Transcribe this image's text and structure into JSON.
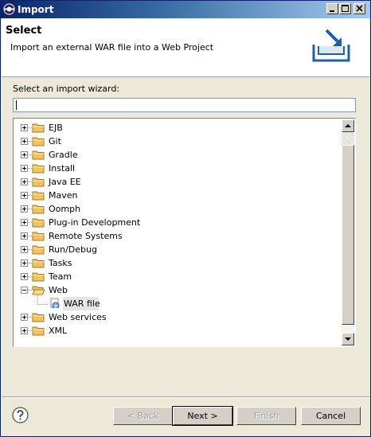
{
  "window": {
    "title": "Import",
    "icons": {
      "app": "eclipse-icon",
      "minimize": "minimize-icon",
      "maximize": "maximize-icon",
      "close": "close-icon"
    }
  },
  "header": {
    "title": "Select",
    "description": "Import an external WAR file into a Web Project",
    "graphic": "import-wizard-banner-icon"
  },
  "wizard": {
    "label": "Select an import wizard:",
    "filter_value": ""
  },
  "tree": {
    "items": [
      {
        "label": "EJB",
        "expanded": false,
        "icon": "folder-icon"
      },
      {
        "label": "Git",
        "expanded": false,
        "icon": "folder-icon"
      },
      {
        "label": "Gradle",
        "expanded": false,
        "icon": "folder-icon"
      },
      {
        "label": "Install",
        "expanded": false,
        "icon": "folder-icon"
      },
      {
        "label": "Java EE",
        "expanded": false,
        "icon": "folder-icon"
      },
      {
        "label": "Maven",
        "expanded": false,
        "icon": "folder-icon"
      },
      {
        "label": "Oomph",
        "expanded": false,
        "icon": "folder-icon"
      },
      {
        "label": "Plug-in Development",
        "expanded": false,
        "icon": "folder-icon"
      },
      {
        "label": "Remote Systems",
        "expanded": false,
        "icon": "folder-icon"
      },
      {
        "label": "Run/Debug",
        "expanded": false,
        "icon": "folder-icon"
      },
      {
        "label": "Tasks",
        "expanded": false,
        "icon": "folder-icon"
      },
      {
        "label": "Team",
        "expanded": false,
        "icon": "folder-icon"
      },
      {
        "label": "Web",
        "expanded": true,
        "icon": "folder-open-icon"
      },
      {
        "label": "WAR file",
        "child": true,
        "selected": true,
        "icon": "war-file-icon"
      },
      {
        "label": "Web services",
        "expanded": false,
        "icon": "folder-icon"
      },
      {
        "label": "XML",
        "expanded": false,
        "icon": "folder-icon"
      }
    ]
  },
  "buttons": {
    "help": "help-icon",
    "back": "< Back",
    "next": "Next >",
    "finish": "Finish",
    "cancel": "Cancel"
  },
  "colors": {
    "titlebar_start": "#0a246a",
    "titlebar_end": "#a6caf0",
    "dialog_bg": "#ece9d8",
    "folder": "#f0c560"
  }
}
